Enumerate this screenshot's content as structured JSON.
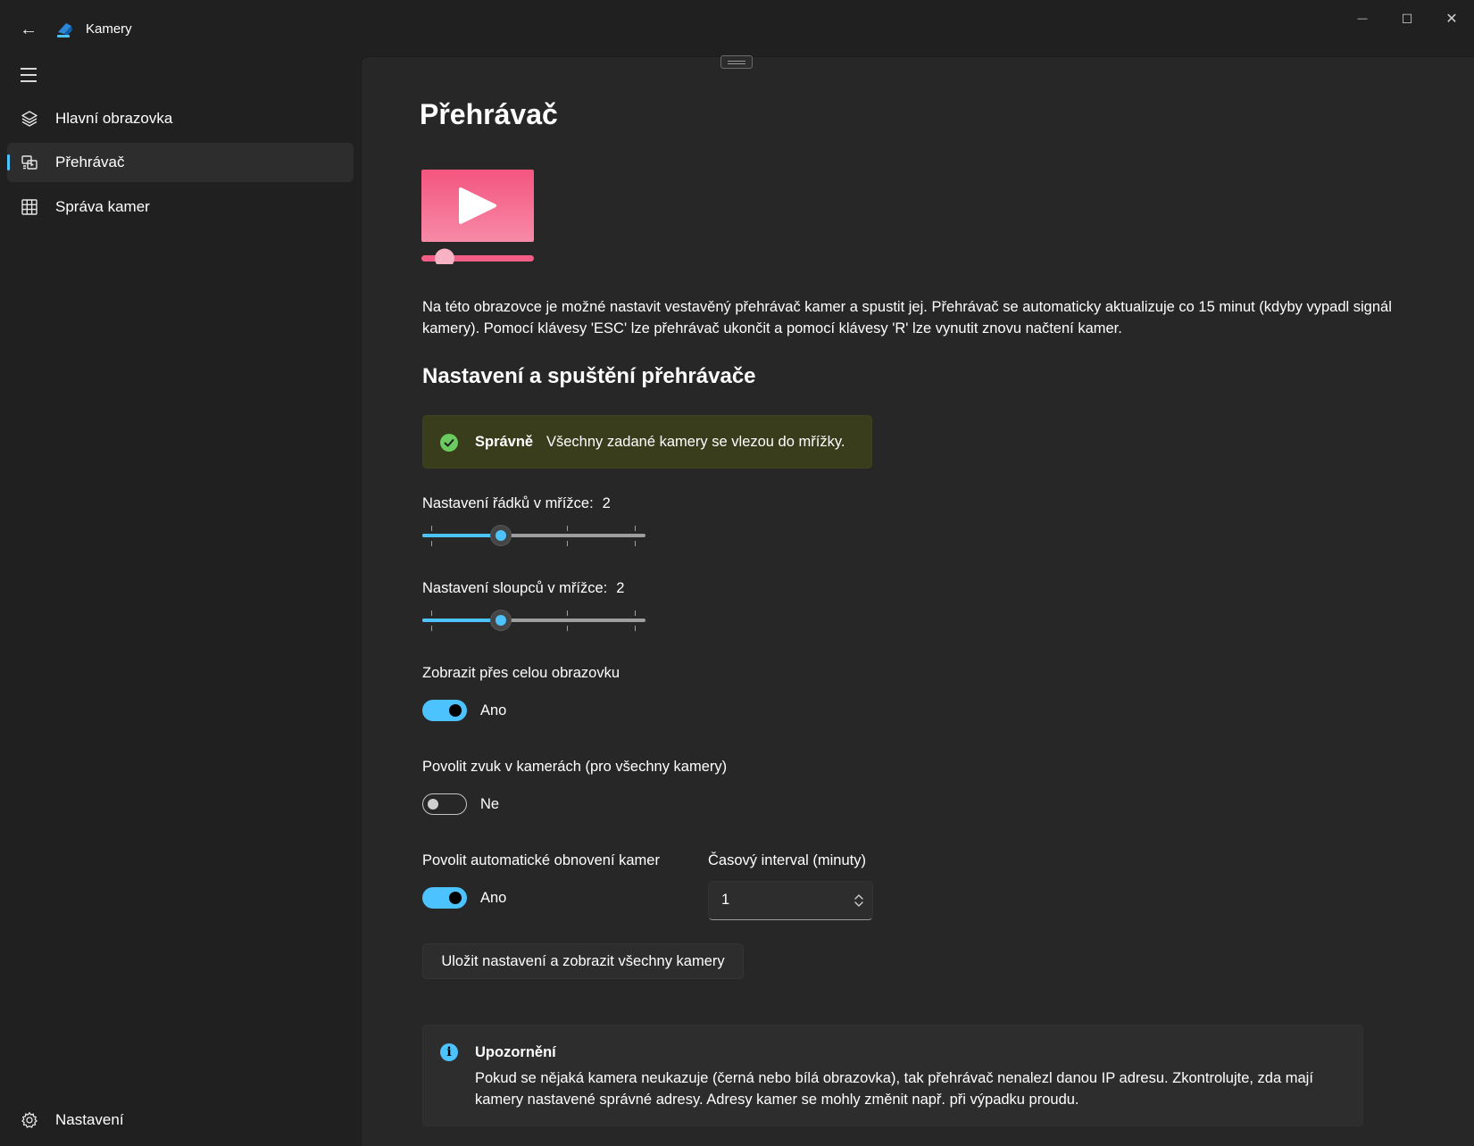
{
  "window": {
    "app_title": "Kamery",
    "minimize_glyph": "—",
    "maximize_glyph": "☐",
    "close_glyph": "✕",
    "back_glyph": "←"
  },
  "colors": {
    "accent": "#4cc2ff",
    "success": "#6ccb5f",
    "hero_gradient_top": "#f45d86",
    "hero_gradient_bottom": "#f77fa0"
  },
  "sidebar": {
    "items": [
      {
        "label": "Hlavní obrazovka",
        "icon": "layers-icon",
        "selected": false
      },
      {
        "label": "Přehrávač",
        "icon": "player-icon",
        "selected": true
      },
      {
        "label": "Správa kamer",
        "icon": "grid-icon",
        "selected": false
      }
    ],
    "footer_item": {
      "label": "Nastavení",
      "icon": "gear-icon"
    }
  },
  "page": {
    "title": "Přehrávač",
    "description": "Na této obrazovce je možné nastavit vestavěný přehrávač kamer a spustit jej. Přehrávač se automaticky aktualizuje co 15 minut (kdyby vypadl signál kamery). Pomocí klávesy 'ESC' lze přehrávač ukončit a pomocí klávesy 'R' lze vynutit znovu načtení kamer.",
    "section_title": "Nastavení a spuštění přehrávače"
  },
  "status_bar": {
    "title": "Správně",
    "message": "Všechny zadané kamery se vlezou do mřížky."
  },
  "rows_setting": {
    "label": "Nastavení řádků v mřížce:",
    "value": "2",
    "min": 0,
    "max": 6,
    "current": 2,
    "slider_fraction": 0.35
  },
  "cols_setting": {
    "label": "Nastavení sloupců v mřížce:",
    "value": "2",
    "min": 0,
    "max": 6,
    "current": 2,
    "slider_fraction": 0.35
  },
  "fullscreen": {
    "label": "Zobrazit přes celou obrazovku",
    "state": true,
    "state_text": "Ano"
  },
  "sound": {
    "label": "Povolit zvuk v kamerách (pro všechny kamery)",
    "state": false,
    "state_text": "Ne"
  },
  "auto_refresh": {
    "label": "Povolit automatické obnovení kamer",
    "state": true,
    "state_text": "Ano"
  },
  "interval": {
    "label": "Časový interval (minuty)",
    "value": "1"
  },
  "save_button": {
    "label": "Uložit nastavení a zobrazit všechny kamery"
  },
  "notice": {
    "title": "Upozornění",
    "message": "Pokud se nějaká kamera neukazuje (černá nebo bílá obrazovka), tak přehrávač nenalezl danou IP adresu. Zkontrolujte, zda mají kamery nastavené správné adresy. Adresy kamer se mohly změnit např. při výpadku proudu.",
    "icon_glyph": "i"
  }
}
